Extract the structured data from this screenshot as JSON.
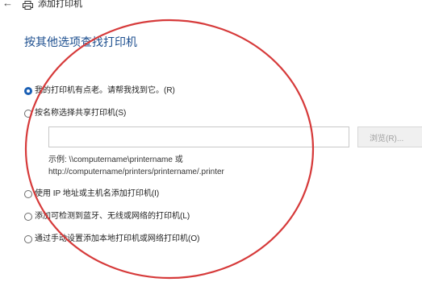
{
  "window": {
    "back_icon": "back-arrow-icon",
    "printer_icon": "printer-icon",
    "title": "添加打印机"
  },
  "heading": "按其他选项查找打印机",
  "options": [
    {
      "label": "我的打印机有点老。请帮我找到它。(R)",
      "checked": true
    },
    {
      "label": "按名称选择共享打印机(S)",
      "checked": false
    },
    {
      "label": "使用 IP 地址或主机名添加打印机(I)",
      "checked": false
    },
    {
      "label": "添加可检测到蓝牙、无线或网络的打印机(L)",
      "checked": false
    },
    {
      "label": "通过手动设置添加本地打印机或网络打印机(O)",
      "checked": false
    }
  ],
  "shared_name": {
    "value": "",
    "browse_label": "浏览(R)...",
    "example_line1": "示例: \\\\computername\\printername 或",
    "example_line2": "http://computername/printers/printername/.printer"
  },
  "colors": {
    "heading": "#1d4f8f",
    "radio_selected": "#1a5fb4",
    "annotation": "#d63a3a"
  }
}
